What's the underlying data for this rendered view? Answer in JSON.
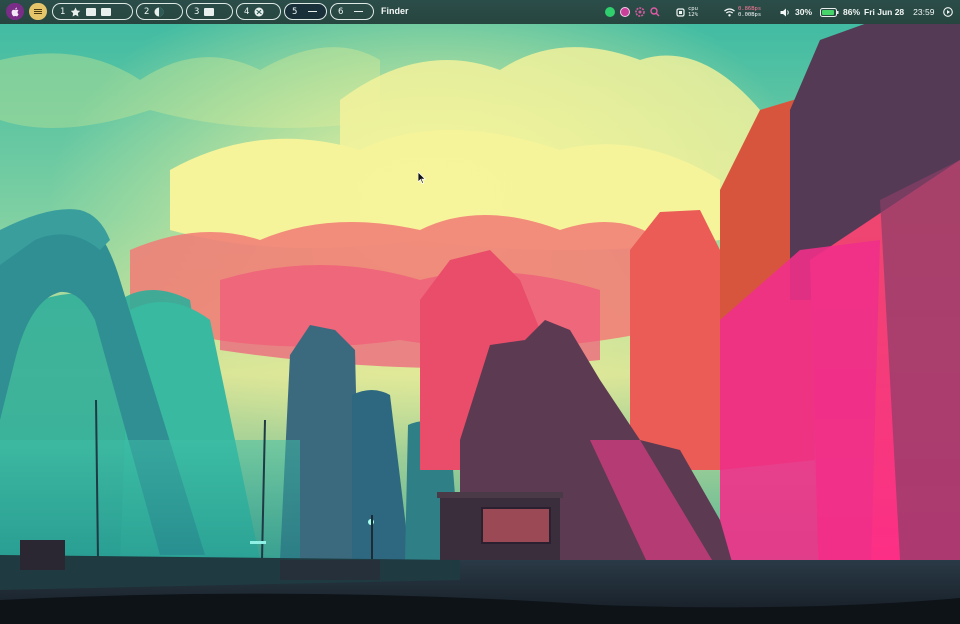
{
  "menubar": {
    "apple_icon": "apple-logo-icon",
    "menu_icon": "hamburger-menu-icon",
    "workspaces": [
      {
        "number": "1",
        "icons": [
          "star-app-icon",
          "window-icon",
          "window-icon"
        ],
        "active": false
      },
      {
        "number": "2",
        "icons": [
          "browser-icon"
        ],
        "active": false
      },
      {
        "number": "3",
        "icons": [
          "window-icon"
        ],
        "active": false
      },
      {
        "number": "4",
        "icons": [
          "globe-icon"
        ],
        "active": false
      },
      {
        "number": "5",
        "icons": [
          "empty-dash"
        ],
        "active": true
      },
      {
        "number": "6",
        "icons": [
          "empty-dash"
        ],
        "active": false
      }
    ],
    "front_app": "Finder",
    "tray": {
      "app_icons": [
        "spotify-icon",
        "tor-browser-icon",
        "settings-app-icon",
        "search-icon"
      ],
      "cpu_label": "cpu",
      "cpu_value": "12%",
      "net_up": "0.86Bps",
      "net_down": "0.00Bps",
      "volume": "30%",
      "battery": "86%",
      "date": "Fri Jun 28",
      "time": "23:59"
    },
    "colors": {
      "bar": "#2b4d49",
      "apple_button": "#7a2d86",
      "menu_button": "#e6c56a",
      "spotify": "#2fcf6e",
      "battery": "#46d36a"
    }
  },
  "desktop": {
    "wallpaper": "synthwave-canyon-illustration"
  }
}
